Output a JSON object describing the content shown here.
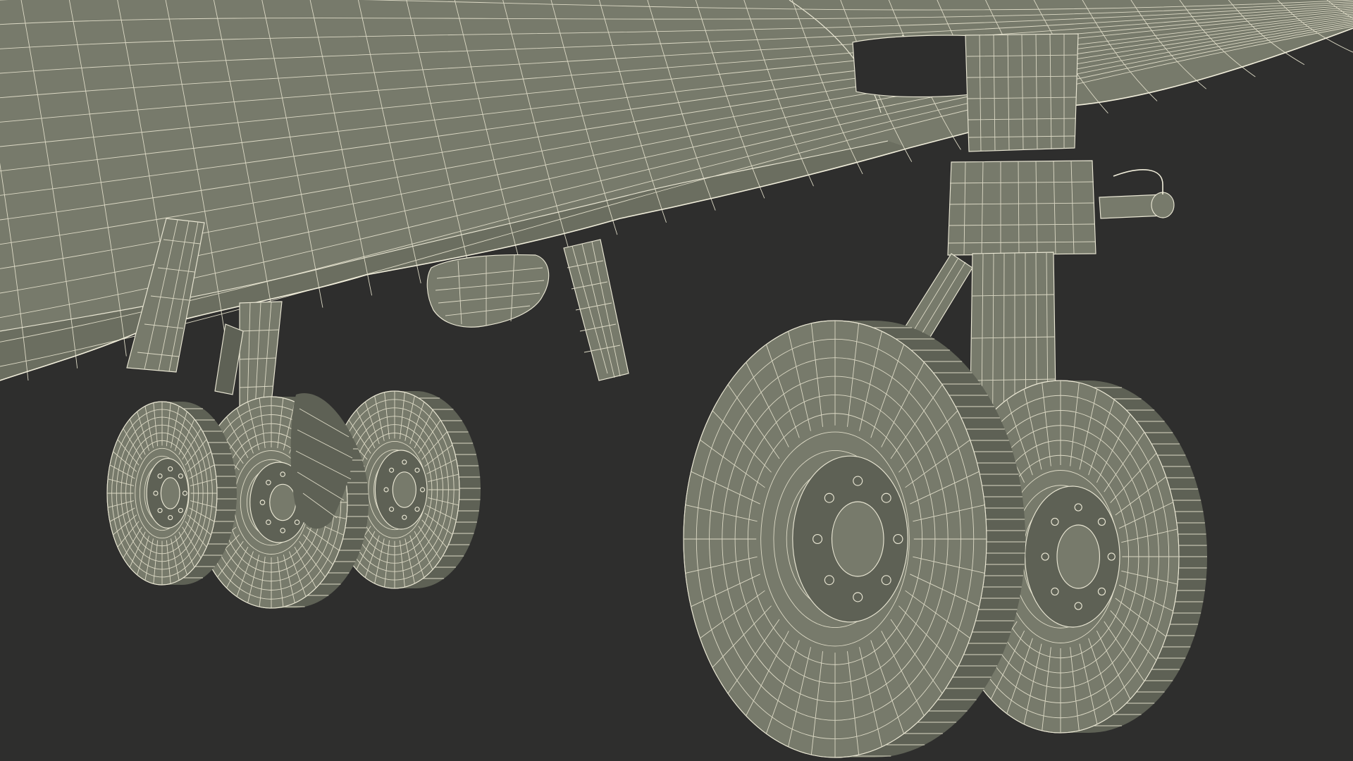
{
  "scene": {
    "background_color": "#2e2e2d",
    "surface_color": "#777a6b",
    "surface_shade_color": "#5e6155",
    "wire_color": "#e9e6d3"
  }
}
